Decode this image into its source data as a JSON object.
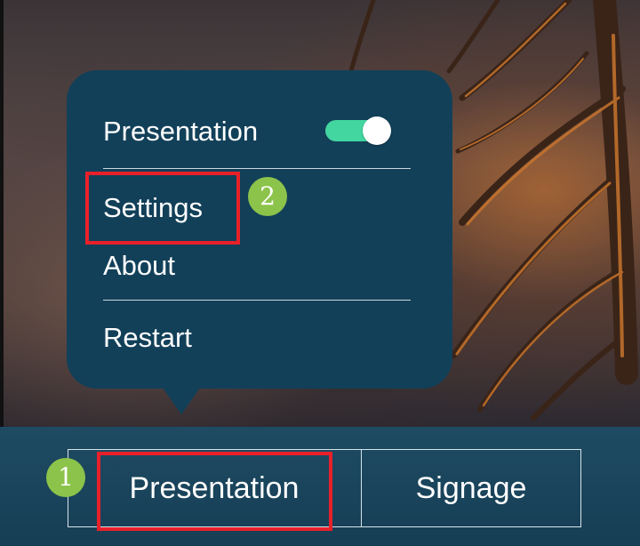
{
  "popup_menu": {
    "toggle_label": "Presentation",
    "toggle_on": true,
    "toggle_color": "#43d6a0",
    "items": [
      {
        "label": "Settings"
      },
      {
        "label": "About"
      },
      {
        "label": "Restart"
      }
    ]
  },
  "taskbar": {
    "tabs": [
      {
        "label": "Presentation"
      },
      {
        "label": "Signage"
      }
    ]
  },
  "annotations": {
    "badge_1": "1",
    "badge_2": "2",
    "highlight_color": "#e8202a",
    "badge_color": "#8cc34a"
  },
  "colors": {
    "menu_background": "#124059",
    "taskbar_background": "#1e4b63"
  }
}
